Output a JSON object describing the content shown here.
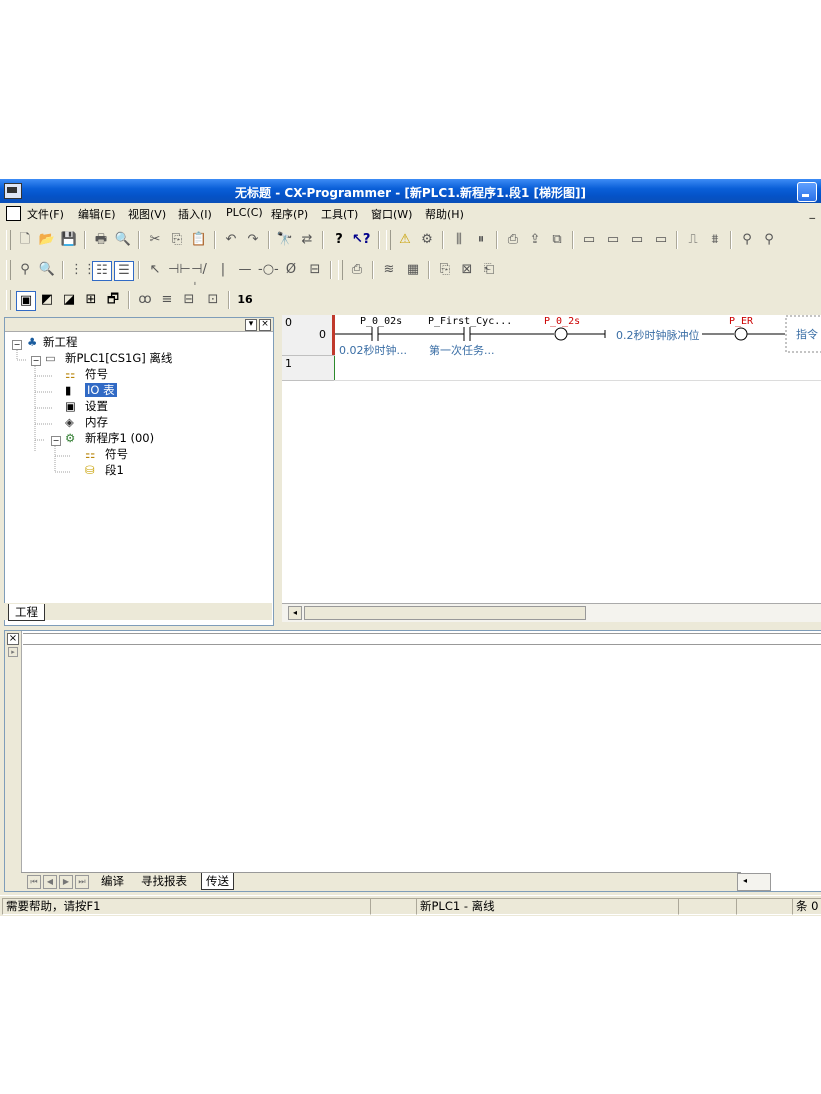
{
  "window": {
    "title": "无标题 - CX-Programmer - [新PLC1.新程序1.段1 [梯形图]]"
  },
  "menu": {
    "items": [
      "文件(F)",
      "编辑(E)",
      "视图(V)",
      "插入(I)",
      "PLC(C)",
      "程序(P)",
      "工具(T)",
      "窗口(W)",
      "帮助(H)"
    ],
    "mdi_minimize": "_"
  },
  "toolbar": {
    "hex_label": "16"
  },
  "project_tree": {
    "root": "新工程",
    "plc": "新PLC1[CS1G] 离线",
    "symbols": "符号",
    "io_table": "IO 表",
    "settings": "设置",
    "memory": "内存",
    "program": "新程序1 (00)",
    "program_symbols": "符号",
    "section": "段1",
    "tab": "工程"
  },
  "ladder": {
    "rungs": [
      {
        "number": "0",
        "step": "0",
        "contacts": [
          {
            "name": "P_0_02s",
            "comment": "0.02秒时钟..."
          },
          {
            "name": "P_First_Cyc...",
            "comment": "第一次任务..."
          }
        ],
        "coils": [
          {
            "name": "P_0_2s",
            "comment": "0.2秒时钟脉冲位"
          },
          {
            "name": "P_ER",
            "comment": ""
          }
        ],
        "instruction_label": "指令"
      },
      {
        "number": "1",
        "step": ""
      }
    ]
  },
  "output": {
    "close": "×",
    "tabs": [
      "编译",
      "寻找报表",
      "传送"
    ],
    "active_tab": "传送"
  },
  "status": {
    "help": "需要帮助，请按F1",
    "plc_status": "新PLC1 - 离线",
    "right": "条 0 ("
  },
  "colors": {
    "title_bar": "#0a5fd8",
    "rung_marker": "#c0392b",
    "comment_text": "#3a6ea5",
    "coil_name": "#cc0000"
  }
}
